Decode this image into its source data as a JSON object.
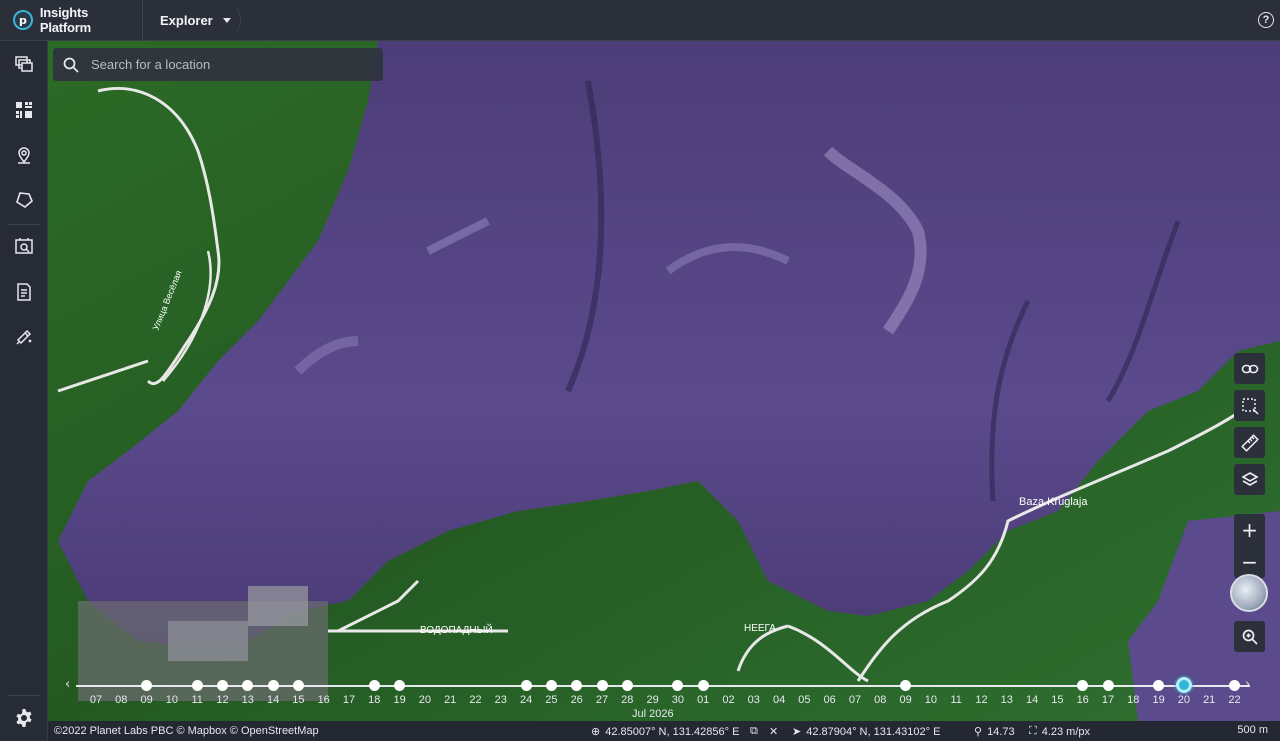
{
  "header": {
    "brand_name": "Insights Platform",
    "brand_letter": "p",
    "app_name": "Explorer"
  },
  "search": {
    "placeholder": "Search for a location"
  },
  "sidebar": {
    "items": [
      {
        "icon": "layers-stack-icon"
      },
      {
        "icon": "dashboard-grid-icon"
      },
      {
        "icon": "location-pin-icon"
      },
      {
        "icon": "polygon-icon"
      },
      {
        "icon": "image-search-icon"
      },
      {
        "icon": "document-icon"
      },
      {
        "icon": "edit-tool-icon"
      },
      {
        "icon": "settings-gear-icon"
      }
    ]
  },
  "map": {
    "labels": {
      "street": "Улица Весёлая",
      "vodopadny": "ВОДОПАДНЫЙ",
      "neega": "НЕЕГА",
      "baza": "Baza Kruglaja"
    },
    "tools": [
      "link-icon",
      "area-select-icon",
      "ruler-icon",
      "layers-icon"
    ],
    "zoom_in": "+",
    "zoom_out": "−"
  },
  "timeline": {
    "month_label": "Jul 2026",
    "days": [
      {
        "label": "07",
        "has_image": false
      },
      {
        "label": "08",
        "has_image": false
      },
      {
        "label": "09",
        "has_image": true
      },
      {
        "label": "10",
        "has_image": false
      },
      {
        "label": "11",
        "has_image": true
      },
      {
        "label": "12",
        "has_image": true
      },
      {
        "label": "13",
        "has_image": true
      },
      {
        "label": "14",
        "has_image": true
      },
      {
        "label": "15",
        "has_image": true
      },
      {
        "label": "16",
        "has_image": false
      },
      {
        "label": "17",
        "has_image": false
      },
      {
        "label": "18",
        "has_image": true
      },
      {
        "label": "19",
        "has_image": true
      },
      {
        "label": "20",
        "has_image": false
      },
      {
        "label": "21",
        "has_image": false
      },
      {
        "label": "22",
        "has_image": false
      },
      {
        "label": "23",
        "has_image": false
      },
      {
        "label": "24",
        "has_image": true
      },
      {
        "label": "25",
        "has_image": true
      },
      {
        "label": "26",
        "has_image": true
      },
      {
        "label": "27",
        "has_image": true
      },
      {
        "label": "28",
        "has_image": true
      },
      {
        "label": "29",
        "has_image": false
      },
      {
        "label": "30",
        "has_image": true
      },
      {
        "label": "01",
        "has_image": true
      },
      {
        "label": "02",
        "has_image": false
      },
      {
        "label": "03",
        "has_image": false
      },
      {
        "label": "04",
        "has_image": false
      },
      {
        "label": "05",
        "has_image": false
      },
      {
        "label": "06",
        "has_image": false
      },
      {
        "label": "07",
        "has_image": false
      },
      {
        "label": "08",
        "has_image": false
      },
      {
        "label": "09",
        "has_image": true
      },
      {
        "label": "10",
        "has_image": false
      },
      {
        "label": "11",
        "has_image": false
      },
      {
        "label": "12",
        "has_image": false
      },
      {
        "label": "13",
        "has_image": false
      },
      {
        "label": "14",
        "has_image": false
      },
      {
        "label": "15",
        "has_image": false
      },
      {
        "label": "16",
        "has_image": true
      },
      {
        "label": "17",
        "has_image": true
      },
      {
        "label": "18",
        "has_image": false
      },
      {
        "label": "19",
        "has_image": true
      },
      {
        "label": "20",
        "has_image": true,
        "active": true
      },
      {
        "label": "21",
        "has_image": false
      },
      {
        "label": "22",
        "has_image": true
      }
    ]
  },
  "status": {
    "attribution": "©2022 Planet Labs PBC © Mapbox © OpenStreetMap",
    "center_coords": "42.85007° N, 131.42856° E",
    "cursor_coords": "42.87904° N, 131.43102° E",
    "zoom_level": "14.73",
    "resolution": "4.23 m/px",
    "scale": "500 m"
  },
  "colors": {
    "accent": "#2fb6d4",
    "water": "#5a4a8a",
    "forest": "#2f6a2a"
  }
}
